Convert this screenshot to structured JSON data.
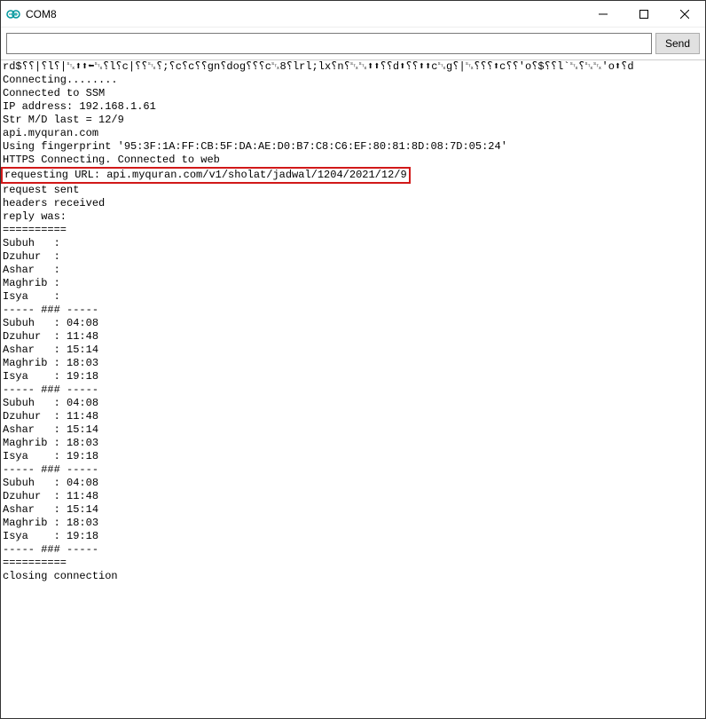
{
  "window": {
    "title": "COM8"
  },
  "toolbar": {
    "input_value": "",
    "input_placeholder": "",
    "send_label": "Send"
  },
  "console": {
    "lines_before": [
      "rd$⸮⸮|⸮l⸮|␂⬆⬆⬅␂⸮l⸮c|⸮⸮␂⸮;⸮c⸮c⸮⸮gn⸮dog⸮⸮⸮c␂8⸮lrl;lx⸮n⸮␂␂⬆⬆⸮⸮d⬆⸮⸮⬆⬆c␂g⸮|␂⸮⸮⸮⬆c⸮⸮'o⸮$⸮⸮l`␂⸮␂␂'o⬆⸮d",
      "Connecting........",
      "Connected to SSM",
      "IP address: 192.168.1.61",
      "Str M/D last = 12/9",
      "api.myquran.com",
      "Using fingerprint '95:3F:1A:FF:CB:5F:DA:AE:D0:B7:C8:C6:EF:80:81:8D:08:7D:05:24'",
      "HTTPS Connecting. Connected to web"
    ],
    "highlighted_line": "requesting URL: api.myquran.com/v1/sholat/jadwal/1204/2021/12/9",
    "lines_after": [
      "request sent",
      "headers received",
      "reply was:",
      "==========",
      "Subuh   :",
      "Dzuhur  :",
      "Ashar   :",
      "Maghrib :",
      "Isya    :",
      "----- ### -----",
      "Subuh   : 04:08",
      "Dzuhur  : 11:48",
      "Ashar   : 15:14",
      "Maghrib : 18:03",
      "Isya    : 19:18",
      "----- ### -----",
      "Subuh   : 04:08",
      "Dzuhur  : 11:48",
      "Ashar   : 15:14",
      "Maghrib : 18:03",
      "Isya    : 19:18",
      "----- ### -----",
      "Subuh   : 04:08",
      "Dzuhur  : 11:48",
      "Ashar   : 15:14",
      "Maghrib : 18:03",
      "Isya    : 19:18",
      "----- ### -----",
      "==========",
      "closing connection"
    ]
  }
}
